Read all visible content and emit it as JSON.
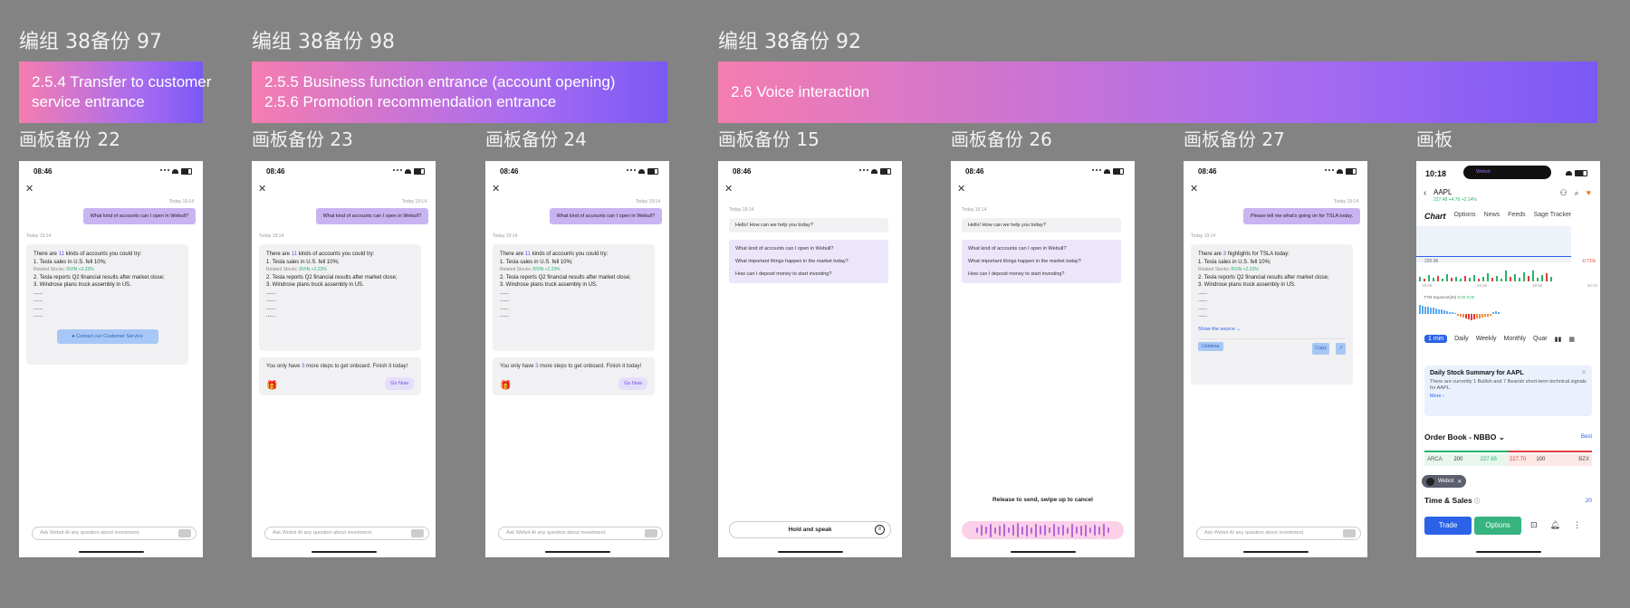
{
  "groups": [
    {
      "title": "编组 38备份 97",
      "band": [
        "2.5.4 Transfer to customer",
        "service entrance"
      ]
    },
    {
      "title": "编组 38备份 98",
      "band": [
        "2.5.5 Business function entrance (account opening)",
        "2.5.6 Promotion recommendation entrance"
      ]
    },
    {
      "title": "编组 38备份 92",
      "band": [
        "2.6 Voice interaction"
      ]
    }
  ],
  "artboards": [
    "画板备份 22",
    "画板备份 23",
    "画板备份 24",
    "画板备份 15",
    "画板备份 26",
    "画板备份 27",
    "画板"
  ],
  "chat": {
    "time": "08:46",
    "timestamp": "Today 19:14",
    "q_accounts": "What kind of accounts can I open in Webull?",
    "q_tsla": "Please tell me what's going on for TSLA today.",
    "ans_pre": "There are ",
    "ans_num": "11",
    "ans_post": " kinds of accounts you could try:",
    "tsla_pre": "There are ",
    "tsla_num": "3",
    "tsla_post": " highlights for TSLA today:",
    "line1": "1. Tesla sales in U.S. fell 10%;",
    "related": "Related Stocks: ",
    "related_val": "RVIN +2.23%",
    "line2": "2. Tesla reports Q2 financial results after market close;",
    "line3": "3. Windrose plans truck assembly in US.",
    "ellipsis": "......",
    "contact": "Contact our Customer Service",
    "onboard_pre": "You only have ",
    "onboard_num": "3",
    "onboard_post": " more steps to get onboard. Finish it today!",
    "go_now": "Go Now",
    "input_placeholder": "Ask Webot AI any question about investment.",
    "greeting": "Hello! How can we help you today?",
    "questions": [
      "What kind of accounts can I open in Webull?",
      "What important things happen in the market today?",
      "How can I deposit money to start investing?"
    ],
    "hold": "Hold and speak",
    "release": "Release to send, swipe up to cancel",
    "show_source": "Show the source",
    "useless": "Useless",
    "copy": "Copy"
  },
  "stock": {
    "time": "10:18",
    "pill": "Webot",
    "ticker": "AAPL",
    "price_line": "227.48 +4.76 +2.14%",
    "tabs": [
      "Chart",
      "Options",
      "News",
      "Feeds",
      "Sage Tracker"
    ],
    "price_label": "225.96",
    "pct_label": "-0.71%",
    "time_labels": [
      "19:08",
      "19:35",
      "19:55",
      "34:10"
    ],
    "ttm": "TTM Squeeze(20)",
    "ttm_vals": "0.02  0.00",
    "periods": [
      "1 min",
      "Daily",
      "Weekly",
      "Monthly",
      "Quar"
    ],
    "summary_title": "Daily Stock Summary for AAPL",
    "summary_text": "There are currently 1 Bullish and 7 Bearish short-term technical signals for AAPL.",
    "more": "More",
    "orderbook": "Order Book - NBBO",
    "best": "Best",
    "ob_row": [
      "ARCA",
      "200",
      "227.65",
      "227.70",
      "100",
      "BZX"
    ],
    "webot": "Webot",
    "ts_title": "Time & Sales",
    "ts_count": "20",
    "trade": "Trade",
    "options": "Options"
  },
  "colors": {
    "accent": "#7b58f5",
    "pink": "#f57db0",
    "bubble": "#c9b4f2",
    "green": "#27b36b",
    "blue": "#2b62e8"
  }
}
